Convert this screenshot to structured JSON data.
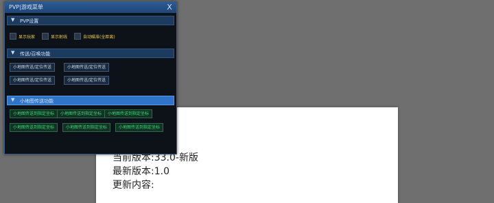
{
  "menu": {
    "title": "PVP|游戏菜单",
    "close_label": "X",
    "sections": [
      {
        "label": "PVP设置",
        "arrow": "▼",
        "checkboxes": [
          {
            "label": "显示玩家"
          },
          {
            "label": "显示射线"
          },
          {
            "label": "自动瞄准(全距离)"
          }
        ]
      },
      {
        "label": "传送/召唤功能",
        "arrow": "▼",
        "buttons": [
          "小地图传送/定位传送",
          "小地图传送/定位传送",
          "小地图传送/定位传送",
          "小地图传送/定位传送"
        ]
      },
      {
        "label": "小地图传送功能",
        "arrow": "▼",
        "buttons": [
          "小地图传送到指定坐标",
          "小地图传送到指定坐标",
          "小地图传送到指定坐标",
          "小地图传送到指定坐标",
          "小地图传送到指定坐标",
          "小地图传送到指定坐标"
        ]
      }
    ]
  },
  "dialog": {
    "current_version": "当前版本:33.0-新版",
    "latest_version": "最新版本:1.0",
    "update_content": "更新内容:"
  },
  "colors": {
    "menu_bg": "#0d1219",
    "titlebar": "#2c5a93",
    "section": "#1d3a5f",
    "section_active": "#2f74c8",
    "checkbox_label": "#e8c84a",
    "green_button_text": "#3fdc74"
  }
}
